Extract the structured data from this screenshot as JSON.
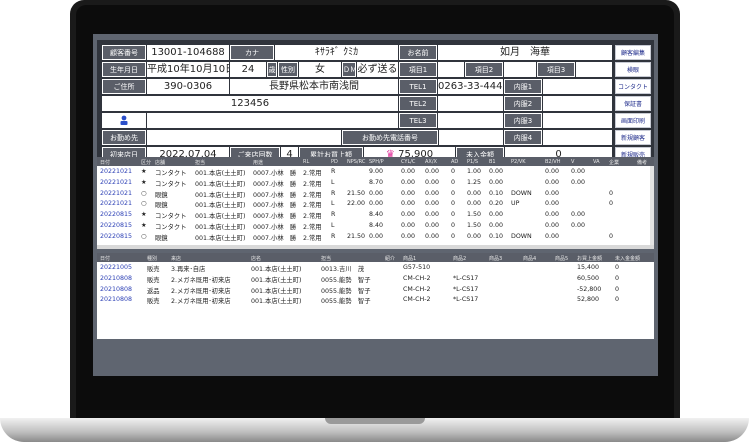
{
  "form": {
    "label_customer_no": "顧客番号",
    "customer_no": "13001-104688",
    "label_kana": "カナ",
    "kana": "ｷｻﾗｷﾞ ｸﾐｶ",
    "label_name": "お名前",
    "name": "如月　海華",
    "label_birthday": "生年月日",
    "birthday": "平成10年10月10日",
    "age": "24",
    "age_unit": "歳",
    "label_gender": "性別",
    "gender": "女",
    "dm_label": "ＤＭ",
    "dm_value": "必ず送る",
    "item1": "項目1",
    "item2": "項目2",
    "item3": "項目3",
    "label_address": "ご住所",
    "postal": "390-0306",
    "address": "長野県松本市南浅間",
    "address2": "123456",
    "tel1": "TEL1",
    "tel1_value": "0263-33-4444",
    "tel2": "TEL2",
    "tel3": "TEL3",
    "naigan1": "内服1",
    "naigan2": "内服2",
    "naigan3": "内服3",
    "naigan4": "内服4",
    "label_workplace": "お勤め先",
    "label_workplace_tel": "お勤め先電話番号",
    "label_first_visit": "初来店日",
    "first_visit": "2022.07.04",
    "label_visits": "ご来店回数",
    "visits": "4",
    "label_total_sales": "累計お買上額",
    "total_sales": "75,900",
    "label_unpaid": "未入金額",
    "unpaid": "0",
    "crown_icon": "crown-icon",
    "person_icon": "person-icon"
  },
  "side_buttons": [
    "顧客編集",
    "検眼",
    "コンタクト",
    "保証書",
    "画面印刷",
    "新規顧客",
    "新規販売"
  ],
  "upper_table": {
    "headers": [
      "日付",
      "区分",
      "店舗",
      "担当",
      "用途",
      "RL",
      "PD",
      "NPS/RC",
      "SPH/P",
      "CYL/C",
      "AX/X",
      "AD",
      "P1/S",
      "B1",
      "P2/VK",
      "B2/VH",
      "V",
      "VA",
      "企業",
      "備考"
    ],
    "rows": [
      [
        "20221021",
        "★",
        "コンタクト",
        "001.本店(土土町)",
        "0007.小林　勝",
        "2.常用",
        "R",
        "",
        "9.00",
        "0.00",
        "0.00",
        "0",
        "1.00",
        "0.00",
        "",
        "0.00",
        "0.00",
        "",
        "",
        ""
      ],
      [
        "20221021",
        "★",
        "コンタクト",
        "001.本店(土土町)",
        "0007.小林　勝",
        "2.常用",
        "L",
        "",
        "8.70",
        "0.00",
        "0.00",
        "0",
        "1.25",
        "0.00",
        "",
        "0.00",
        "0.00",
        "",
        "",
        ""
      ],
      [
        "20221021",
        "○",
        "眼鏡",
        "001.本店(土土町)",
        "0007.小林　勝",
        "2.常用",
        "R",
        "21.50",
        "0.00",
        "0.00",
        "0.00",
        "0",
        "0.00",
        "0.10",
        "DOWN",
        "0.00",
        "",
        "",
        "0",
        ""
      ],
      [
        "20221021",
        "○",
        "眼鏡",
        "001.本店(土土町)",
        "0007.小林　勝",
        "2.常用",
        "L",
        "22.00",
        "0.00",
        "0.00",
        "0.00",
        "0",
        "0.00",
        "0.20",
        "UP",
        "0.00",
        "",
        "",
        "0",
        ""
      ],
      [
        "20220815",
        "★",
        "コンタクト",
        "001.本店(土土町)",
        "0007.小林　勝",
        "2.常用",
        "R",
        "",
        "8.40",
        "0.00",
        "0.00",
        "0",
        "1.50",
        "0.00",
        "",
        "0.00",
        "0.00",
        "",
        "",
        ""
      ],
      [
        "20220815",
        "★",
        "コンタクト",
        "001.本店(土土町)",
        "0007.小林　勝",
        "2.常用",
        "L",
        "",
        "8.40",
        "0.00",
        "0.00",
        "0",
        "1.50",
        "0.00",
        "",
        "0.00",
        "0.00",
        "",
        "",
        ""
      ],
      [
        "20220815",
        "○",
        "眼鏡",
        "001.本店(土土町)",
        "0007.小林　勝",
        "2.常用",
        "R",
        "21.50",
        "0.00",
        "0.00",
        "0.00",
        "0",
        "0.00",
        "0.10",
        "DOWN",
        "0.00",
        "",
        "",
        "0",
        ""
      ]
    ]
  },
  "lower_table": {
    "headers": [
      "日付",
      "種別",
      "来店",
      "店名",
      "担当",
      "紹介",
      "商品1",
      "商品2",
      "商品3",
      "商品4",
      "商品5",
      "お買上金額",
      "未入金金額"
    ],
    "rows": [
      [
        "20221005",
        "販売",
        "3.再来･自店",
        "001.本店(土土町)",
        "0013.吉川　茂",
        "",
        "G57-510",
        "",
        "",
        "",
        "",
        "15,400",
        "0"
      ],
      [
        "20210808",
        "販売",
        "2.メガネ既用･初来店",
        "001.本店(土土町)",
        "0055.能勢　智子",
        "",
        "CM-CH-2",
        "*L-CS17",
        "",
        "",
        "",
        "60,500",
        "0"
      ],
      [
        "20210808",
        "返品",
        "2.メガネ既用･初来店",
        "001.本店(土土町)",
        "0055.能勢　智子",
        "",
        "CM-CH-2",
        "*L-CS17",
        "",
        "",
        "",
        "-52,800",
        "0"
      ],
      [
        "20210808",
        "販売",
        "2.メガネ既用･初来店",
        "001.本店(土土町)",
        "0055.能勢　智子",
        "",
        "CM-CH-2",
        "*L-CS17",
        "",
        "",
        "",
        "52,800",
        "0"
      ]
    ]
  }
}
